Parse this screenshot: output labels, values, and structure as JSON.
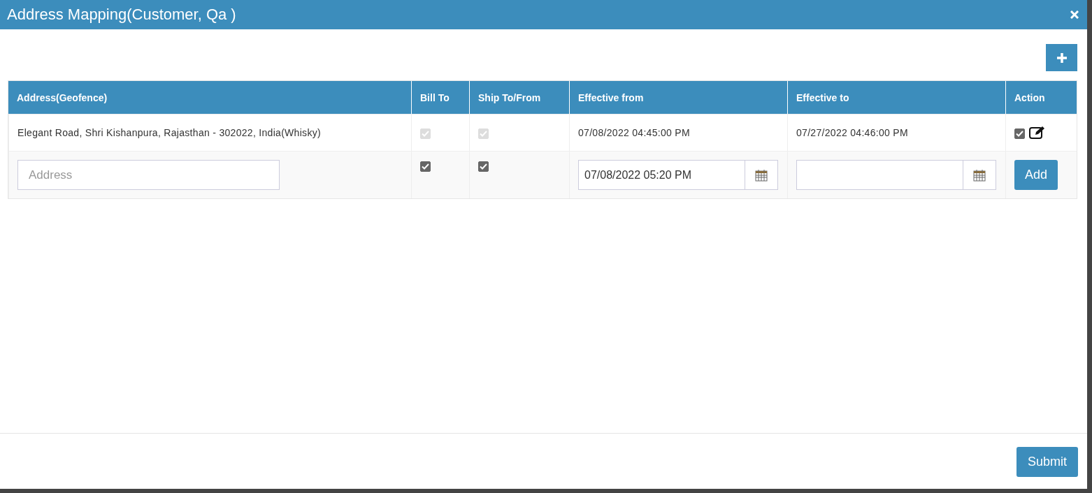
{
  "window": {
    "title": "Address Mapping(Customer, Qa )"
  },
  "table": {
    "columns": [
      "Address(Geofence)",
      "Bill To",
      "Ship To/From",
      "Effective from",
      "Effective to",
      "Action"
    ],
    "rows": [
      {
        "address": "Elegant Road, Shri Kishanpura, Rajasthan - 302022, India(Whisky)",
        "bill_to": {
          "checked": true,
          "disabled": true
        },
        "ship_to": {
          "checked": true,
          "disabled": true
        },
        "effective_from": "07/08/2022 04:45:00 PM",
        "effective_to": "07/27/2022 04:46:00 PM",
        "action_checked": true
      }
    ]
  },
  "new_row": {
    "address": {
      "placeholder": "Address"
    },
    "bill_to": {
      "checked": true,
      "disabled": false
    },
    "ship_to": {
      "checked": true,
      "disabled": false
    },
    "effective_from": {
      "value": "07/08/2022 05:20 PM"
    },
    "add_button": "Add"
  },
  "footer": {
    "submit_button": "Submit"
  }
}
